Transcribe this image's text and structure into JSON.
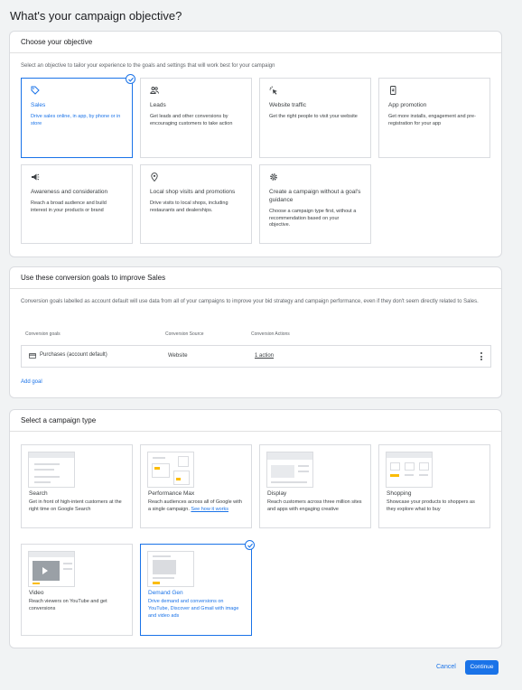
{
  "page": {
    "title": "What's your campaign objective?"
  },
  "objective": {
    "header": "Choose your objective",
    "description": "Select an objective to tailor your experience to the goals and settings that will work best for your campaign",
    "tiles": [
      {
        "title": "Sales",
        "desc": "Drive sales online, in app, by phone or in store",
        "icon": "tag-icon",
        "selected": true
      },
      {
        "title": "Leads",
        "desc": "Get leads and other conversions by encouraging customers to take action",
        "icon": "people-icon"
      },
      {
        "title": "Website traffic",
        "desc": "Get the right people to visit your website",
        "icon": "cursor-click-icon"
      },
      {
        "title": "App promotion",
        "desc": "Get more installs, engagement and pre-registration for your app",
        "icon": "phone-icon"
      },
      {
        "title": "Awareness and consideration",
        "desc": "Reach a broad audience and build interest in your products or brand",
        "icon": "megaphone-icon"
      },
      {
        "title": "Local shop visits and promotions",
        "desc": "Drive visits to local shops, including restaurants and dealerships.",
        "icon": "location-pin-icon"
      },
      {
        "title": "Create a campaign without a goal's guidance",
        "desc": "Choose a campaign type first, without a recommendation based on your objective.",
        "icon": "gear-icon"
      }
    ]
  },
  "conversion": {
    "header": "Use these conversion goals to improve Sales",
    "description": "Conversion goals labelled as account default will use data from all of your campaigns to improve your bid strategy and campaign performance, even if they don't seem directly related to Sales.",
    "columns": [
      "Conversion goals",
      "Conversion Source",
      "Conversion Actions"
    ],
    "row": {
      "goal": "Purchases (account default)",
      "source": "Website",
      "actions": "1 action"
    },
    "add_goal": "Add goal"
  },
  "campaign": {
    "header": "Select a campaign type",
    "tiles": [
      {
        "title": "Search",
        "desc": "Get in front of high-intent customers at the right time on Google Search"
      },
      {
        "title": "Performance Max",
        "desc": "Reach audiences across all of Google with a single campaign.",
        "link": "See how it works"
      },
      {
        "title": "Display",
        "desc": "Reach customers across three million sites and apps with engaging creative"
      },
      {
        "title": "Shopping",
        "desc": "Showcase your products to shoppers as they explore what to buy"
      },
      {
        "title": "Video",
        "desc": "Reach viewers on YouTube and get conversions"
      },
      {
        "title": "Demand Gen",
        "desc": "Drive demand and conversions on YouTube, Discover and Gmail with image and video ads",
        "selected": true
      }
    ]
  },
  "footer": {
    "cancel": "Cancel",
    "continue": "Continue"
  },
  "colors": {
    "accent": "#1a73e8",
    "thumb_accent": "#fbbc04"
  }
}
